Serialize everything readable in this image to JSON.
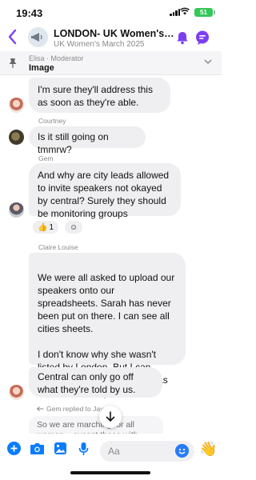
{
  "status_bar": {
    "time": "19:43",
    "battery": "51"
  },
  "header": {
    "title": "LONDON- UK Women's M...",
    "subtitle": "UK Women's March 2025"
  },
  "pinned": {
    "author": "Elisa · Moderator",
    "text": "Image"
  },
  "messages": [
    {
      "sender": "",
      "text": "I'm sure they'll address this as soon as they're able."
    },
    {
      "sender": "Courtney",
      "text": "Is it still going on tmmrw?"
    },
    {
      "sender": "Gem",
      "text": "And why are city leads allowed to invite speakers not okayed by central? Surely they should be monitoring groups"
    },
    {
      "sender": "Claire Louise",
      "text": "We were all asked to upload our speakers onto our spreadsheets. Sarah has never been put on there. I can see all cities sheets.\n\nI don't know why she wasn't listed by London. But I can vouch for the fact that she was never on their spreadsheet."
    },
    {
      "sender": "",
      "text": "Central can only go off what they're told by us."
    }
  ],
  "reactions": [
    {
      "emoji": "👍",
      "count": "1"
    },
    {
      "emoji": "☺",
      "count": ""
    }
  ],
  "reply": {
    "label": "Gem replied to Jay",
    "preview": "So we are marching for all women... except those with lived"
  },
  "composer": {
    "placeholder": "Aa",
    "send_emoji": "👋"
  },
  "colors": {
    "accent": "#7b3ff2",
    "brand_blue": "#0a7cff",
    "bubble": "#efeff1"
  }
}
